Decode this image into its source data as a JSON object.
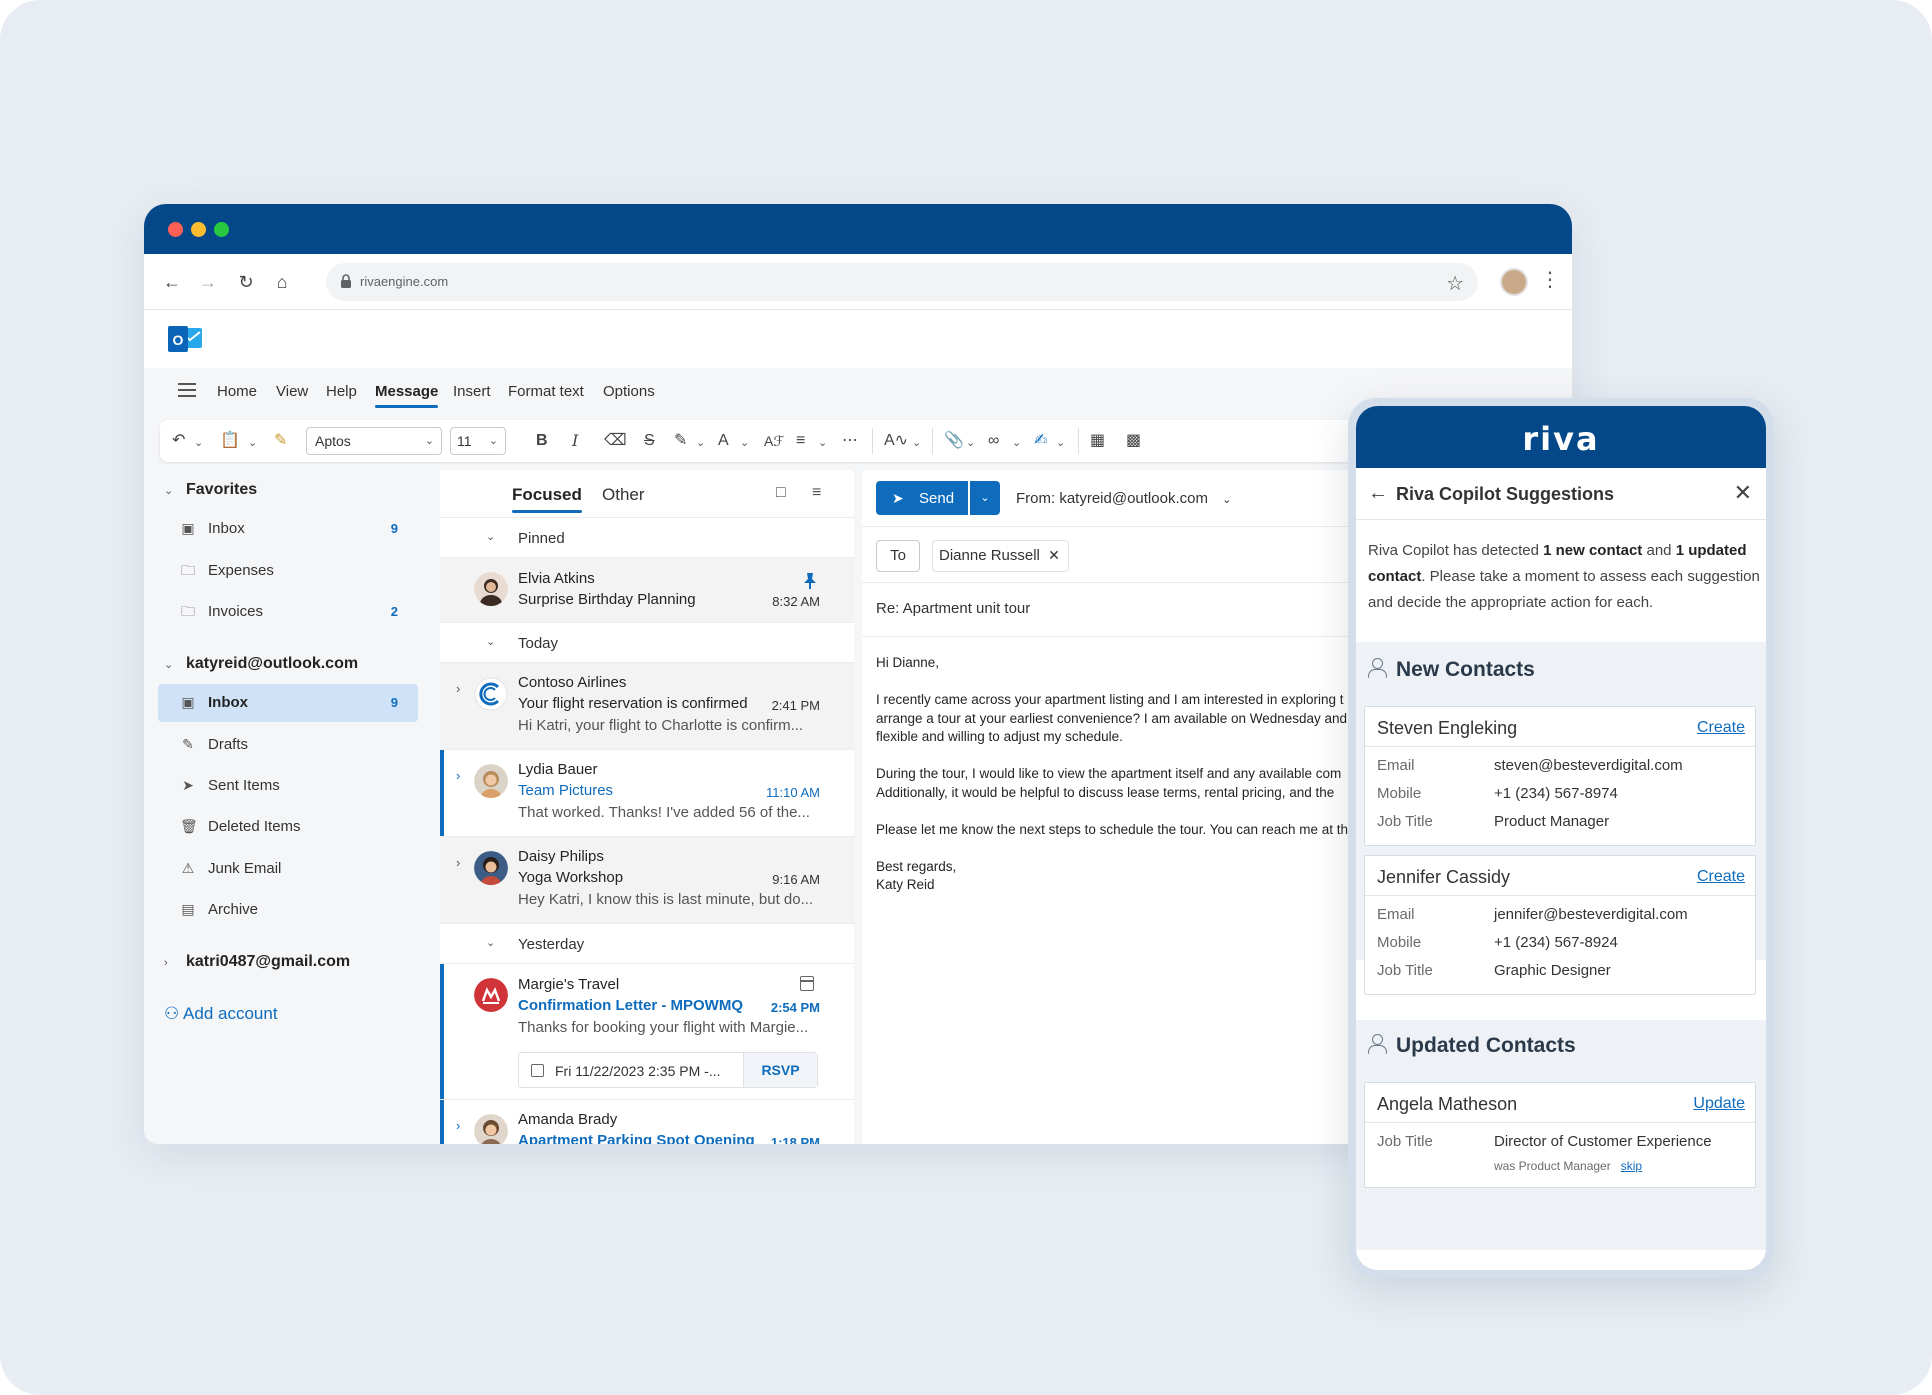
{
  "browser": {
    "url": "rivaengine.com"
  },
  "ribbon": {
    "tabs": [
      "Home",
      "View",
      "Help",
      "Message",
      "Insert",
      "Format text",
      "Options"
    ],
    "active_tab": "Message",
    "font_name": "Aptos",
    "font_size": "11"
  },
  "sidebar": {
    "favorites_label": "Favorites",
    "favorites": [
      {
        "label": "Inbox",
        "count": "9"
      },
      {
        "label": "Expenses",
        "count": ""
      },
      {
        "label": "Invoices",
        "count": "2"
      }
    ],
    "account1": "katyreid@outlook.com",
    "folders": [
      {
        "label": "Inbox",
        "count": "9"
      },
      {
        "label": "Drafts",
        "count": ""
      },
      {
        "label": "Sent Items",
        "count": ""
      },
      {
        "label": "Deleted Items",
        "count": ""
      },
      {
        "label": "Junk Email",
        "count": ""
      },
      {
        "label": "Archive",
        "count": ""
      }
    ],
    "account2": "katri0487@gmail.com",
    "add_account": "Add account"
  },
  "message_list": {
    "tab_focused": "Focused",
    "tab_other": "Other",
    "sections": {
      "pinned": "Pinned",
      "today": "Today",
      "yesterday": "Yesterday"
    },
    "messages": [
      {
        "from": "Elvia Atkins",
        "subject": "Surprise Birthday Planning",
        "preview": "",
        "time": "8:32 AM"
      },
      {
        "from": "Contoso Airlines",
        "subject": "Your flight reservation is confirmed",
        "preview": "Hi Katri, your flight to Charlotte is confirm...",
        "time": "2:41 PM"
      },
      {
        "from": "Lydia Bauer",
        "subject": "Team Pictures",
        "preview": "That worked. Thanks! I've added 56 of the...",
        "time": "11:10 AM"
      },
      {
        "from": "Daisy Philips",
        "subject": "Yoga Workshop",
        "preview": "Hey Katri, I know this is last minute, but do...",
        "time": "9:16 AM"
      },
      {
        "from": "Margie's Travel",
        "subject": "Confirmation Letter - MPOWMQ",
        "preview": "Thanks for booking your flight with Margie...",
        "time": "2:54 PM",
        "event_when": "Fri 11/22/2023 2:35 PM -...",
        "rsvp": "RSVP"
      },
      {
        "from": "Amanda Brady",
        "subject": "Apartment Parking Spot Opening",
        "preview": "",
        "time": "1:18 PM"
      }
    ]
  },
  "compose": {
    "send_label": "Send",
    "from": "From: katyreid@outlook.com",
    "to_label": "To",
    "recipient": "Dianne Russell",
    "subject": "Re: Apartment unit tour",
    "greeting": "Hi Dianne,",
    "para1_line1": "I recently came across your apartment listing and I am interested in exploring t",
    "para1_line2": "arrange a tour at your earliest convenience? I am available on Wednesday and",
    "para1_line3": "flexible and willing to adjust my schedule.",
    "para2_line1": "During the tour, I would like to view the apartment itself and any available com",
    "para2_line2": "Additionally, it would be helpful to discuss lease terms, rental pricing, and the",
    "para3_line1": "Please let me know the next steps to schedule the tour. You can reach me at th",
    "signoff1": "Best regards,",
    "signoff2": "Katy Reid"
  },
  "riva": {
    "logo": "riva",
    "panel_title": "Riva Copilot Suggestions",
    "intro_a": "Riva Copilot has detected ",
    "intro_b": "1 new contact",
    "intro_c": " and ",
    "intro_d": "1 updated contact",
    "intro_e": ". Please take a moment to assess each suggestion and decide the appropriate action for each.",
    "new_contacts_title": "New Contacts",
    "updated_contacts_title": "Updated Contacts",
    "labels": {
      "email": "Email",
      "mobile": "Mobile",
      "job_title": "Job Title"
    },
    "new_contacts": [
      {
        "name": "Steven Engleking",
        "action": "Create",
        "email": "steven@besteverdigital.com",
        "mobile": "+1 (234) 567-8974",
        "job_title": "Product Manager"
      },
      {
        "name": "Jennifer Cassidy",
        "action": "Create",
        "email": "jennifer@besteverdigital.com",
        "mobile": "+1 (234) 567-8924",
        "job_title": "Graphic Designer"
      }
    ],
    "updated_contacts": [
      {
        "name": "Angela Matheson",
        "action": "Update",
        "job_title": "Director of Customer Experience",
        "was": "was Product Manager",
        "skip": "skip"
      }
    ]
  },
  "colors": {
    "brand_blue": "#04488a",
    "accent_blue": "#0f6cbd",
    "selected_bg": "#cfe2f7"
  }
}
